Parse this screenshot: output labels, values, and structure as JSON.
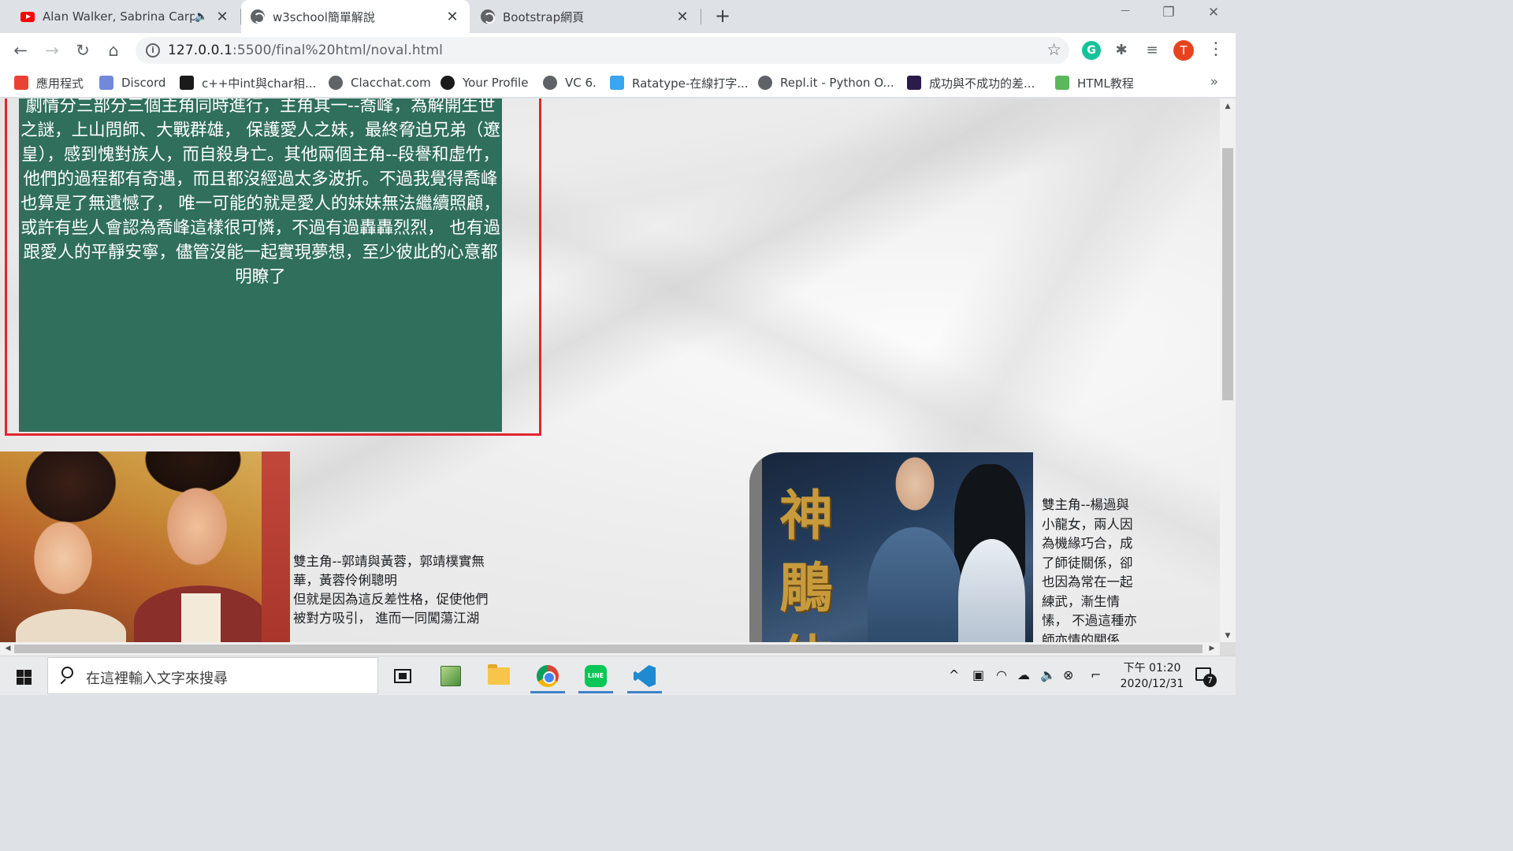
{
  "browser": {
    "tabs": [
      {
        "title": "Alan Walker, Sabrina Carpe",
        "icon": "youtube-icon",
        "audible": true,
        "active": false
      },
      {
        "title": "w3school簡單解說",
        "icon": "globe-icon",
        "active": true
      },
      {
        "title": "Bootstrap網頁",
        "icon": "globe-icon",
        "active": false
      }
    ],
    "new_tab_label": "+",
    "window_controls": {
      "minimize": "—",
      "restore": "❐",
      "close": "✕"
    },
    "url": {
      "host": "127.0.0.1",
      "path": ":5500/final%20html/noval.html"
    },
    "profile_initial": "T",
    "bookmarks": [
      {
        "label": "應用程式",
        "color": "#e94235"
      },
      {
        "label": "Discord",
        "color": "#7289da"
      },
      {
        "label": "c++中int與char相...",
        "color": "#1a1a1a"
      },
      {
        "label": "Clacchat.com",
        "color": "#5f6368"
      },
      {
        "label": "Your Profile",
        "color": "#1a1a1a"
      },
      {
        "label": "VC 6.",
        "color": "#5f6368"
      },
      {
        "label": "Ratatype-在線打字...",
        "color": "#3aa5f0"
      },
      {
        "label": "Repl.it - Python O...",
        "color": "#5f6368"
      },
      {
        "label": "成功與不成功的差...",
        "color": "#2b1b4a"
      },
      {
        "label": "HTML教程",
        "color": "#5cb85c"
      }
    ],
    "bookmarks_more": "»"
  },
  "page": {
    "plot_text": "劇情分三部分三個主角同時進行，主角其一--喬峰，為解開生世之謎，上山問師、大戰群雄， 保護愛人之妹，最終脅迫兄弟（遼皇），感到愧對族人，而自殺身亡。其他兩個主角--段譽和虛竹， 他們的過程都有奇遇，而且都沒經過太多波折。不過我覺得喬峰也算是了無遺憾了， 唯一可能的就是愛人的妹妹無法繼續照顧，或許有些人會認為喬峰這樣很可憐，不過有過轟轟烈烈， 也有過跟愛人的平靜安寧，儘管沒能一起實現夢想，至少彼此的心意都明瞭了",
    "caption_left_line1": "雙主角--郭靖與黃蓉，郭靖樸實無華，黃蓉伶俐聰明",
    "caption_left_line2": "但就是因為這反差性格，促使他們被對方吸引， 進而一同闖蕩江湖",
    "caption_right": "雙主角--楊過與小龍女，兩人因為機緣巧合，成了師徒關係，卻也因為常在一起練武，漸生情愫， 不過這種亦師亦情的關係",
    "poster_right_title": "神鵰俠"
  },
  "taskbar": {
    "search_placeholder": "在這裡輸入文字來搜尋",
    "clock_time": "下午 01:20",
    "clock_date": "2020/12/31",
    "notification_count": "7"
  },
  "colors": {
    "plot_box_bg": "#2f6f5b",
    "highlight_outline": "#e0262d"
  }
}
